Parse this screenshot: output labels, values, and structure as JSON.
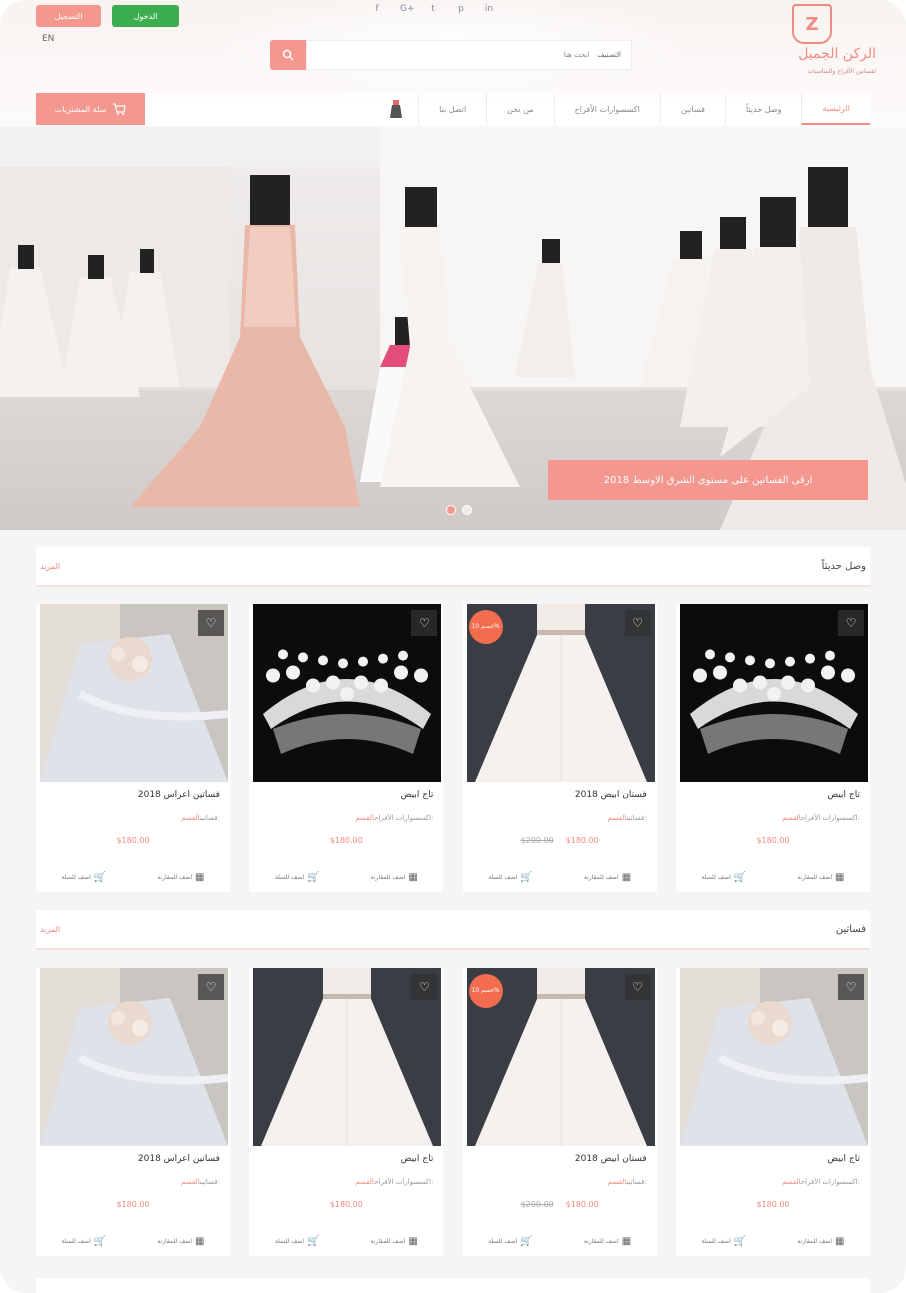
{
  "header": {
    "register_label": "التسجيل",
    "login_label": "الدخول",
    "lang": "EN",
    "socials": [
      "f",
      "G+",
      "t",
      "p",
      "in"
    ],
    "search_category": "التصنيف",
    "search_placeholder": "ابحث هنا"
  },
  "logo": {
    "mark": "Z",
    "name": "الركن الجميل",
    "tagline": "لفساتين الأفراح والمناسبات"
  },
  "nav": {
    "items": [
      "الرئيسية",
      "وصل حديثاً",
      "فساتين",
      "اكسسوارات الأفراح",
      "من نحن",
      "اتصل بنا"
    ],
    "cart_label": "سلة المشتريات"
  },
  "hero": {
    "caption": "ارقى الفساتين على مستوى الشرق الاوسط 2018",
    "dots": [
      true,
      false
    ]
  },
  "sections": [
    {
      "title": "وصل حديثاً",
      "more": "المزيد",
      "products": [
        {
          "name": "تاج ابيض",
          "category_label": "القسم:",
          "category": "اكسسوارات الأفراح",
          "price": "$180.00",
          "old_price": "",
          "badge": "",
          "image": "tiara"
        },
        {
          "name": "فستان ابيض 2018",
          "category_label": "القسم:",
          "category": "فساتين",
          "price": "$180.00",
          "old_price": "$200.00",
          "badge": "خصم 10%",
          "image": "white-dress"
        },
        {
          "name": "تاج ابيض",
          "category_label": "القسم:",
          "category": "اكسسوارات الأفراح",
          "price": "$180.00",
          "old_price": "",
          "badge": "",
          "image": "tiara"
        },
        {
          "name": "فساتين اعراس 2018",
          "category_label": "القسم:",
          "category": "فساتين",
          "price": "$180.00",
          "old_price": "",
          "badge": "",
          "image": "lace-dress"
        }
      ]
    },
    {
      "title": "فساتين",
      "more": "المزيد",
      "products": [
        {
          "name": "تاج ابيض",
          "category_label": "القسم:",
          "category": "اكسسوارات الأفراح",
          "price": "$180.00",
          "old_price": "",
          "badge": "",
          "image": "lace-dress"
        },
        {
          "name": "فستان ابيض 2018",
          "category_label": "القسم:",
          "category": "فساتين",
          "price": "$180.00",
          "old_price": "$200.00",
          "badge": "خصم 10%",
          "image": "white-dress"
        },
        {
          "name": "تاج ابيض",
          "category_label": "القسم:",
          "category": "اكسسوارات الأفراح",
          "price": "$180.00",
          "old_price": "",
          "badge": "",
          "image": "white-dress"
        },
        {
          "name": "فساتين اعراس 2018",
          "category_label": "القسم:",
          "category": "فساتين",
          "price": "$180.00",
          "old_price": "",
          "badge": "",
          "image": "lace-dress"
        }
      ]
    }
  ],
  "card_actions": {
    "compare": "اضف للمقارنة",
    "cart": "اضف للسلة"
  },
  "colors": {
    "accent": "#f4978e",
    "login": "#3dae4f",
    "badge": "#f26d4f"
  }
}
